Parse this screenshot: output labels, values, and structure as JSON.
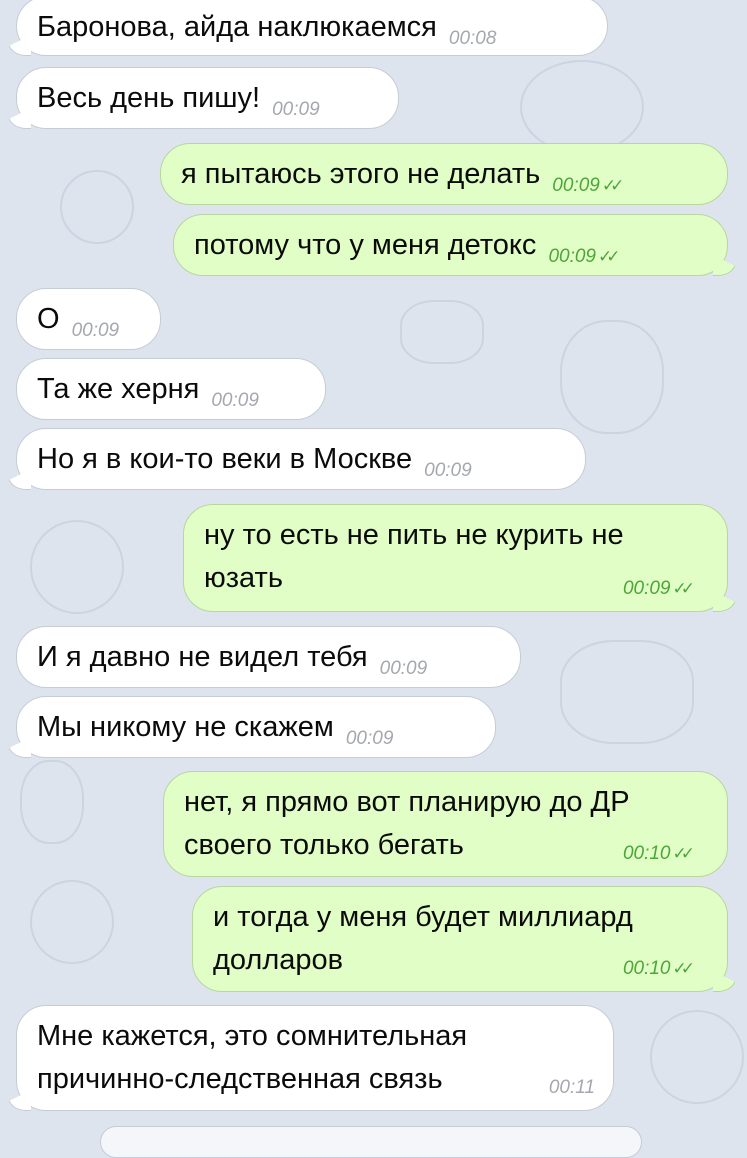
{
  "messages": [
    {
      "direction": "in",
      "text": "Баронова, айда наклюкаемся",
      "time": "00:08"
    },
    {
      "direction": "in",
      "text": "Весь день пишу!",
      "time": "00:09"
    },
    {
      "direction": "out",
      "text": "я пытаюсь этого не делать",
      "time": "00:09",
      "status": "read"
    },
    {
      "direction": "out",
      "text": "потому что у меня детокс",
      "time": "00:09",
      "status": "read"
    },
    {
      "direction": "in",
      "text": "О",
      "time": "00:09"
    },
    {
      "direction": "in",
      "text": "Та же херня",
      "time": "00:09"
    },
    {
      "direction": "in",
      "text": "Но я в кои-то веки в Москве",
      "time": "00:09"
    },
    {
      "direction": "out",
      "text": "ну то есть не пить  не курить не юзать",
      "time": "00:09",
      "status": "read"
    },
    {
      "direction": "in",
      "text": "И я давно не видел тебя",
      "time": "00:09"
    },
    {
      "direction": "in",
      "text": "Мы никому не скажем",
      "time": "00:09"
    },
    {
      "direction": "out",
      "text": "нет, я прямо вот планирую до ДР своего только бегать",
      "time": "00:10",
      "status": "read"
    },
    {
      "direction": "out",
      "text": "и тогда у меня будет миллиард долларов",
      "time": "00:10",
      "status": "read"
    },
    {
      "direction": "in",
      "text": "Мне кажется, это сомнительная причинно-следственная связь",
      "time": "00:11"
    }
  ],
  "icons": {
    "read_receipt": "double-check-icon"
  },
  "colors": {
    "background": "#dde4ee",
    "incoming_bubble": "#ffffff",
    "outgoing_bubble": "#e1fec6",
    "read_check": "#4ea53a",
    "time_incoming": "#a4a8ae"
  }
}
